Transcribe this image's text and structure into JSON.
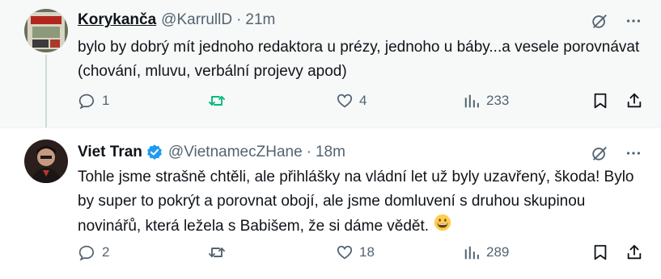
{
  "tweets": [
    {
      "author_name": "Korykanča",
      "handle": "@KarrullD",
      "time": "21m",
      "text": "bylo by dobrý mít jednoho redaktora u prézy, jednoho u báby...a vesele porovnávat (chování, mluvu, verbální projevy apod)",
      "replies": "1",
      "retweets": "",
      "likes": "4",
      "views": "233"
    },
    {
      "author_name": "Viet Tran",
      "handle": "@VietnamecZHane",
      "time": "18m",
      "text": "Tohle jsme strašně chtěli, ale přihlášky na vládní let už byly uzavřený, škoda! Bylo by super to pokrýt a porovnat obojí, ale jsme domluvení s druhou skupinou novinářů, která ležela s Babišem, že si dáme vědět.",
      "emoji": "grinning-face-emoji",
      "replies": "2",
      "retweets": "",
      "likes": "18",
      "views": "289"
    }
  ],
  "separator": "·",
  "colors": {
    "accent": "#1d9bf0",
    "retweet_green": "#00ba7c",
    "muted": "#536471",
    "text": "#0f1419",
    "highlight_bg": "#f7f9f9"
  },
  "icons": [
    "reply-icon",
    "retweet-icon",
    "like-icon",
    "views-icon",
    "bookmark-icon",
    "share-icon",
    "grok-icon",
    "more-icon",
    "verified-badge-icon"
  ]
}
